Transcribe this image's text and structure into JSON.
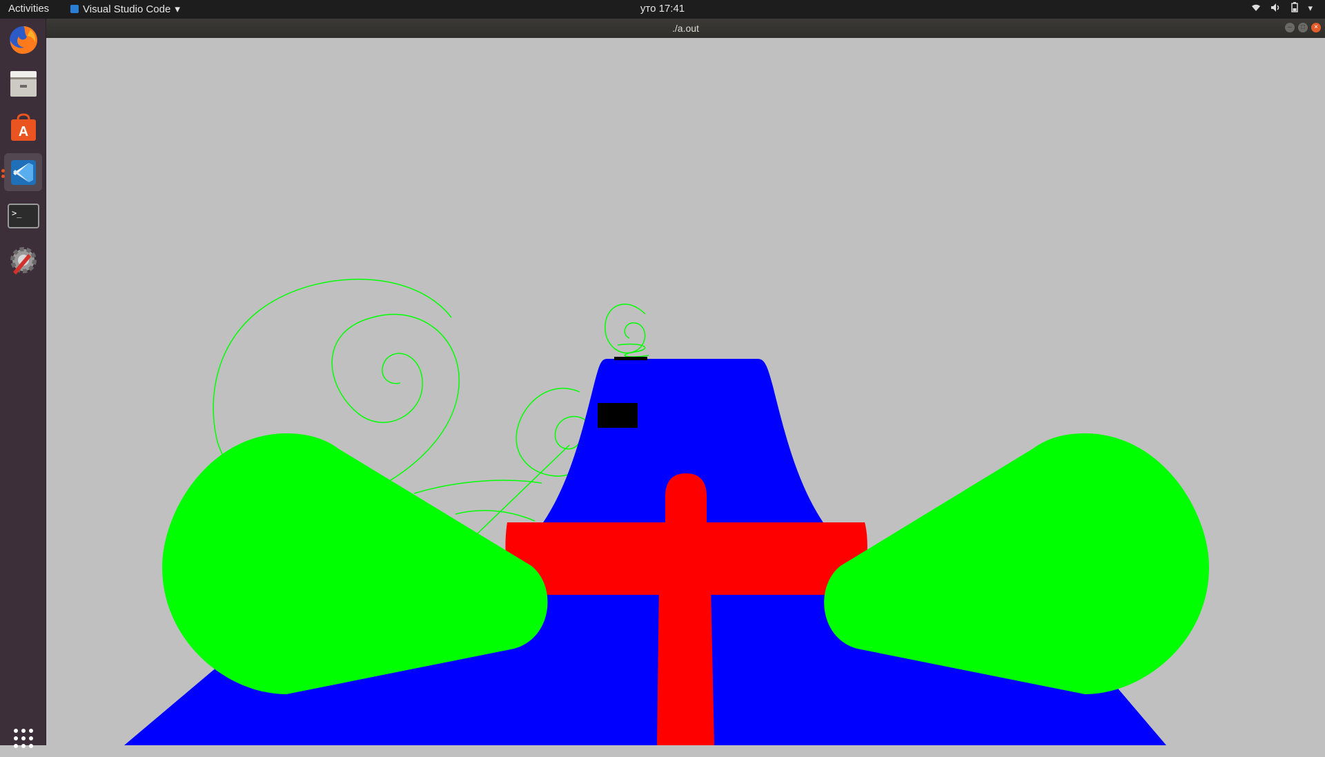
{
  "topbar": {
    "activities": "Activities",
    "app_menu": "Visual Studio Code",
    "clock": "уто 17:41"
  },
  "window": {
    "title": "./a.out"
  },
  "dock": {
    "items": [
      {
        "name": "firefox-icon"
      },
      {
        "name": "files-icon"
      },
      {
        "name": "software-center-icon"
      },
      {
        "name": "vscode-icon"
      },
      {
        "name": "terminal-icon"
      },
      {
        "name": "settings-icon"
      },
      {
        "name": "show-applications-icon"
      }
    ]
  },
  "scene": {
    "colors": {
      "background": "#c0c0c0",
      "blue": "#0000ff",
      "red": "#ff0000",
      "green": "#00ff00",
      "black": "#000000"
    }
  }
}
